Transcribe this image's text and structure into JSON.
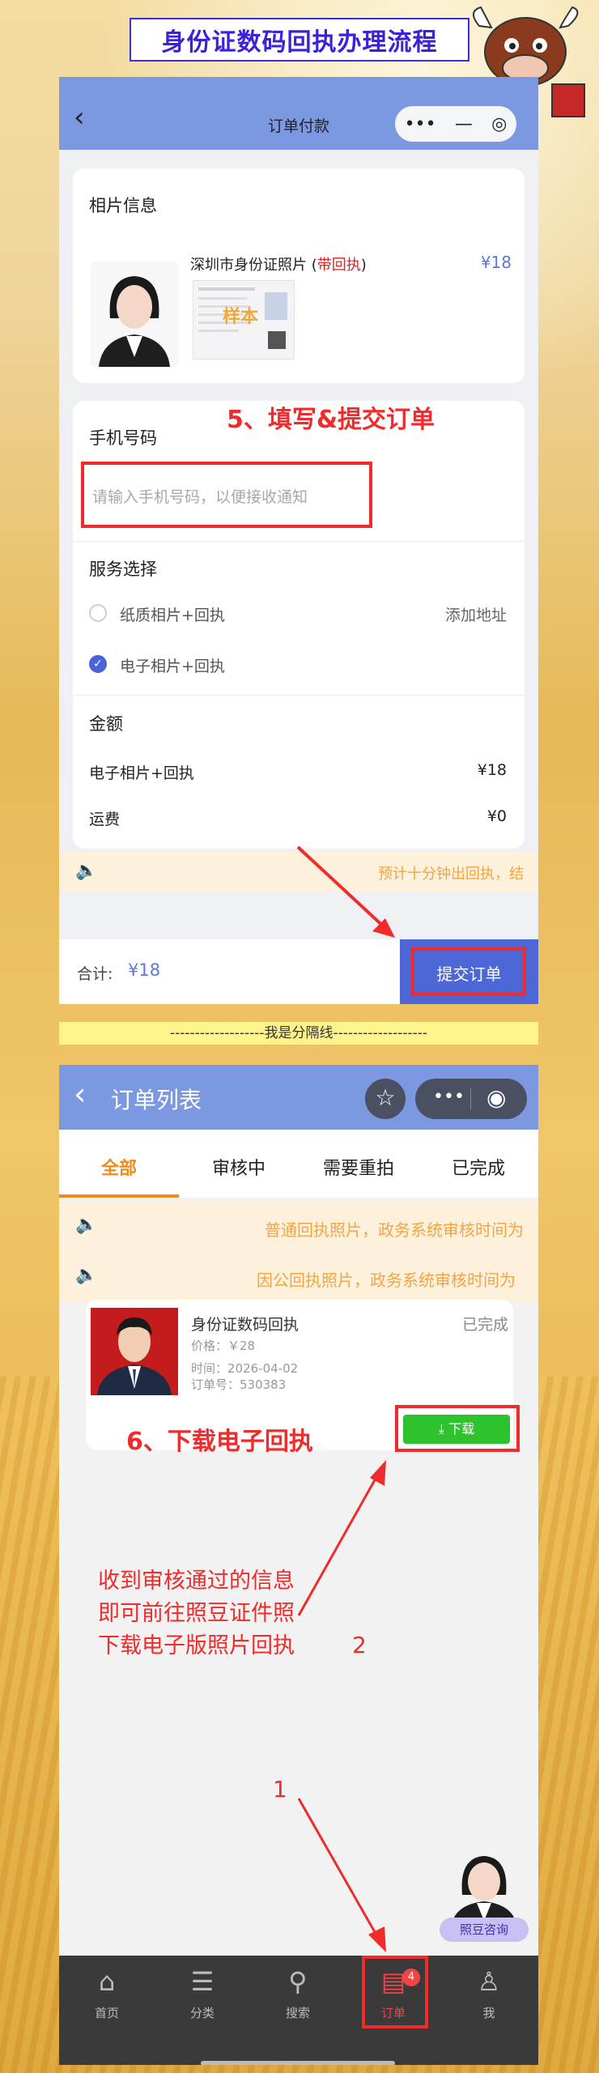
{
  "banner": {
    "title": "身份证数码回执办理流程"
  },
  "screen1": {
    "nav_title": "订单付款",
    "photo_section_title": "相片信息",
    "product": {
      "name_prefix": "深圳市身份证照片 (",
      "name_highlight": "带回执",
      "name_suffix": ")",
      "price": "¥18",
      "watermark": "样本"
    },
    "annotation_step5": "5、填写&提交订单",
    "phone_label": "手机号码",
    "phone_placeholder": "请输入手机号码，以便接收通知",
    "service_title": "服务选择",
    "services": [
      {
        "label": "纸质相片+回执",
        "selected": false,
        "extra": "添加地址"
      },
      {
        "label": "电子相片+回执",
        "selected": true,
        "extra": ""
      }
    ],
    "amount_title": "金额",
    "amount_rows": [
      {
        "label": "电子相片+回执",
        "value": "¥18"
      },
      {
        "label": "运费",
        "value": "¥0"
      }
    ],
    "notice": "预计十分钟出回执，结",
    "total_label": "合计:",
    "total_value": "¥18",
    "submit_label": "提交订单"
  },
  "divider_text": "-------------------我是分隔线-------------------",
  "screen2": {
    "nav_title": "订单列表",
    "tabs": [
      "全部",
      "审核中",
      "需要重拍",
      "已完成"
    ],
    "notices": [
      "普通回执照片，政务系统审核时间为",
      "因公回执照片，政务系统审核时间为"
    ],
    "order": {
      "title": "身份证数码回执",
      "status": "已完成",
      "price": "价格：￥28",
      "time": "时间：2026-04-02",
      "order_no": "订单号：530383",
      "download_label": "下载"
    },
    "annotation_step6": "6、下载电子回执",
    "hint_lines": [
      "收到审核通过的信息",
      "即可前往照豆证件照",
      "下载电子版照片回执"
    ],
    "arrow_label_1": "1",
    "arrow_label_2": "2",
    "consult_label": "照豆咨询",
    "tabbar": [
      {
        "label": "首页",
        "icon": "home-icon"
      },
      {
        "label": "分类",
        "icon": "category-icon"
      },
      {
        "label": "搜索",
        "icon": "search-icon"
      },
      {
        "label": "订单",
        "icon": "order-icon",
        "badge": "4",
        "active": true
      },
      {
        "label": "我",
        "icon": "user-icon"
      }
    ]
  },
  "colors": {
    "nav": "#7b98e0",
    "accent_orange": "#f08a1a",
    "annotation_red": "#ef2b2b",
    "submit_blue": "#4e67d6"
  }
}
